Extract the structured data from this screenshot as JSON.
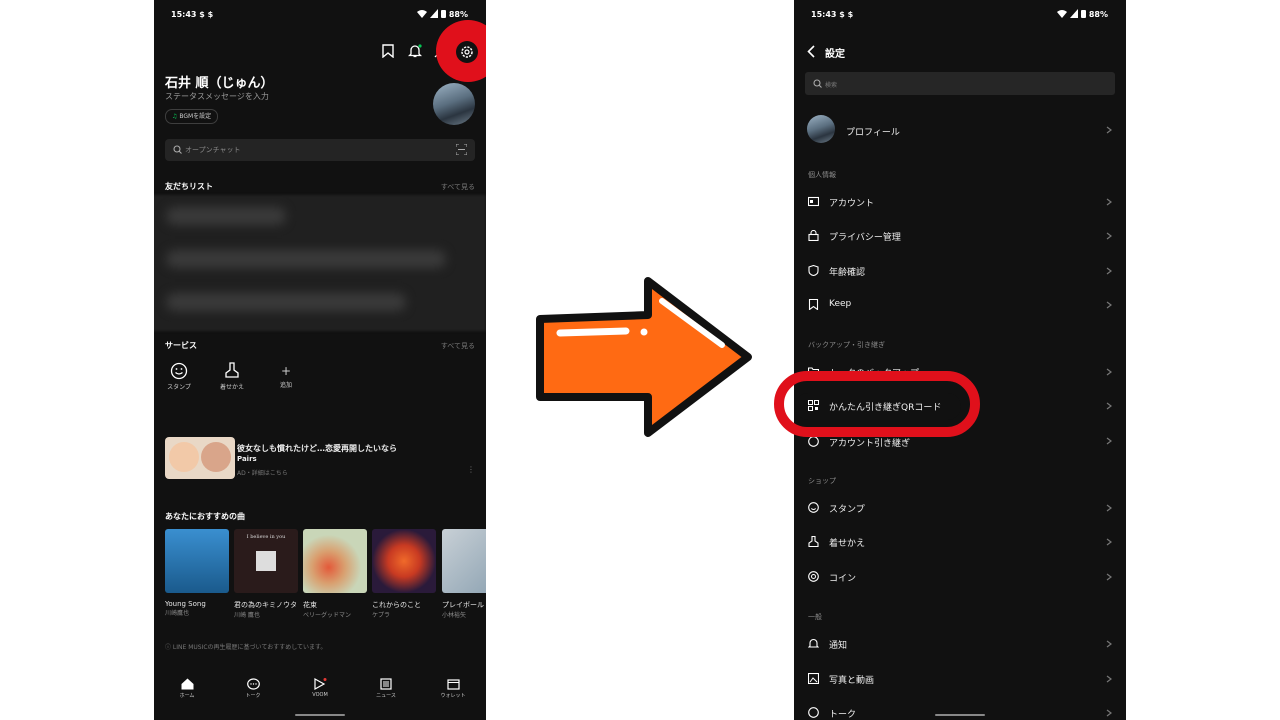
{
  "left_screen": {
    "status": {
      "time": "15:43 $ $",
      "battery": "88%"
    },
    "profile": {
      "name": "石井 順（じゅん）",
      "status_placeholder": "ステータスメッセージを入力",
      "bgm_label": "BGMを設定"
    },
    "search_placeholder": "オープンチャット",
    "friends": {
      "title": "友だちリスト",
      "see_all": "すべて見る"
    },
    "services": {
      "title": "サービス",
      "see_all": "すべて見る",
      "items": [
        {
          "label": "スタンプ",
          "icon": "smile-icon"
        },
        {
          "label": "着せかえ",
          "icon": "brush-icon"
        },
        {
          "label": "追加",
          "icon": "plus-icon"
        }
      ]
    },
    "ad": {
      "title": "彼女なしも慣れたけど…恋愛再開したいなら",
      "brand": "Pairs",
      "meta": "AD・詳細はこちら"
    },
    "music": {
      "title": "あなたにおすすめの曲",
      "songs": [
        {
          "title": "Young Song",
          "artist": "川崎鷹也",
          "color": "#2f7fb8"
        },
        {
          "title": "君の為のキミノウタ",
          "artist": "川崎 鷹也",
          "color": "#2a1b1b"
        },
        {
          "title": "花束",
          "artist": "ベリーグッドマン",
          "color": "#c9d6b8"
        },
        {
          "title": "これからのこと",
          "artist": "ケプラ",
          "color": "#c83a22"
        },
        {
          "title": "プレイボール",
          "artist": "小林裕矢",
          "color": "#8aa0b0"
        }
      ],
      "album2_text": "I believe in you",
      "footnote": "LINE MUSICの再生履歴に基づいておすすめしています。"
    },
    "nav": [
      {
        "label": "ホーム",
        "icon": "home-icon"
      },
      {
        "label": "トーク",
        "icon": "chat-icon"
      },
      {
        "label": "VOOM",
        "icon": "voom-icon"
      },
      {
        "label": "ニュース",
        "icon": "news-icon"
      },
      {
        "label": "ウォレット",
        "icon": "wallet-icon"
      }
    ]
  },
  "right_screen": {
    "status": {
      "time": "15:43 $ $",
      "battery": "88%"
    },
    "title": "設定",
    "search_placeholder": "検索",
    "profile_label": "プロフィール",
    "sections": {
      "personal": "個人情報",
      "backup": "バックアップ・引き継ぎ",
      "shop": "ショップ",
      "general": "一般"
    },
    "rows": {
      "account": "アカウント",
      "privacy": "プライバシー管理",
      "age": "年齢確認",
      "keep": "Keep",
      "talk_backup": "トークのバックアップ",
      "qr_transfer": "かんたん引き継ぎQRコード",
      "account_transfer": "アカウント引き継ぎ",
      "stamp": "スタンプ",
      "theme": "着せかえ",
      "coin": "コイン",
      "notify": "通知",
      "photo_video": "写真と動画",
      "talk": "トーク"
    }
  },
  "colors": {
    "highlight": "#e0101b",
    "arrow_fill": "#ff6a13",
    "phone_bg": "#111111"
  }
}
